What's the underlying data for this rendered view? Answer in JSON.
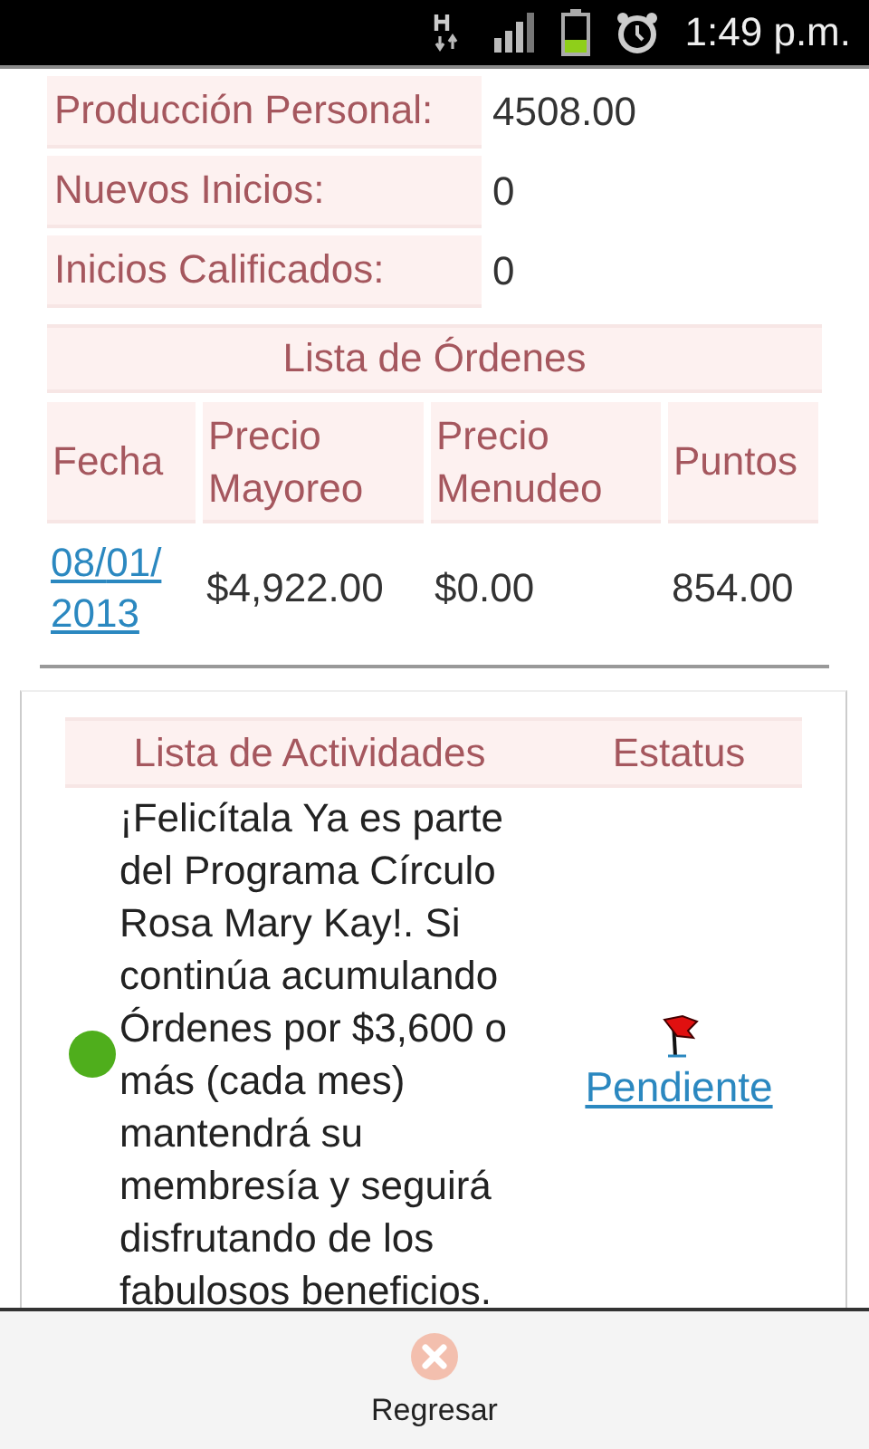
{
  "status_bar": {
    "time": "1:49 p.m."
  },
  "summary": [
    {
      "label": "Producción Personal:",
      "value": "4508.00"
    },
    {
      "label": "Nuevos Inicios:",
      "value": "0"
    },
    {
      "label": "Inicios Calificados:",
      "value": "0"
    }
  ],
  "orders": {
    "title": "Lista de Órdenes",
    "columns": [
      "Fecha",
      "Precio Mayoreo",
      "Precio Menudeo",
      "Puntos"
    ],
    "rows": [
      {
        "date": "08/01/2013",
        "wholesale": "$4,922.00",
        "retail": "$0.00",
        "points": "854.00"
      }
    ]
  },
  "activities": {
    "columns": [
      "Lista de Actividades",
      "Estatus"
    ],
    "items": [
      {
        "color": "#4fae1c",
        "text": "¡Felicítala Ya es parte del Programa Círculo Rosa Mary Kay!. Si continúa acumulando Órdenes por $3,600 o más (cada mes) mantendrá su membresía y seguirá disfrutando de los fabulosos beneficios.",
        "status": "Pendiente"
      }
    ]
  },
  "bottom_bar": {
    "button": "Regresar"
  }
}
